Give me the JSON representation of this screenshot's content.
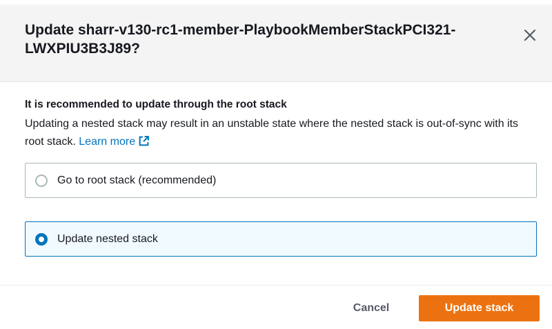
{
  "modal": {
    "title": "Update sharr-v130-rc1-member-PlaybookMemberStackPCI321-LWXPIU3B3J89?",
    "close_icon": "close-icon"
  },
  "alert": {
    "heading": "It is recommended to update through the root stack",
    "text": "Updating a nested stack may result in an unstable state where the nested stack is out-of-sync with its root stack.",
    "link_text": "Learn more",
    "link_icon": "external-link-icon"
  },
  "options": [
    {
      "label": "Go to root stack (recommended)",
      "selected": false
    },
    {
      "label": "Update nested stack",
      "selected": true
    }
  ],
  "footer": {
    "cancel_label": "Cancel",
    "primary_label": "Update stack"
  },
  "colors": {
    "primary": "#ec7211",
    "link": "#0073bb",
    "selected_border": "#0073bb",
    "selected_background": "#f1faff",
    "header_background": "#f4f4f4"
  }
}
